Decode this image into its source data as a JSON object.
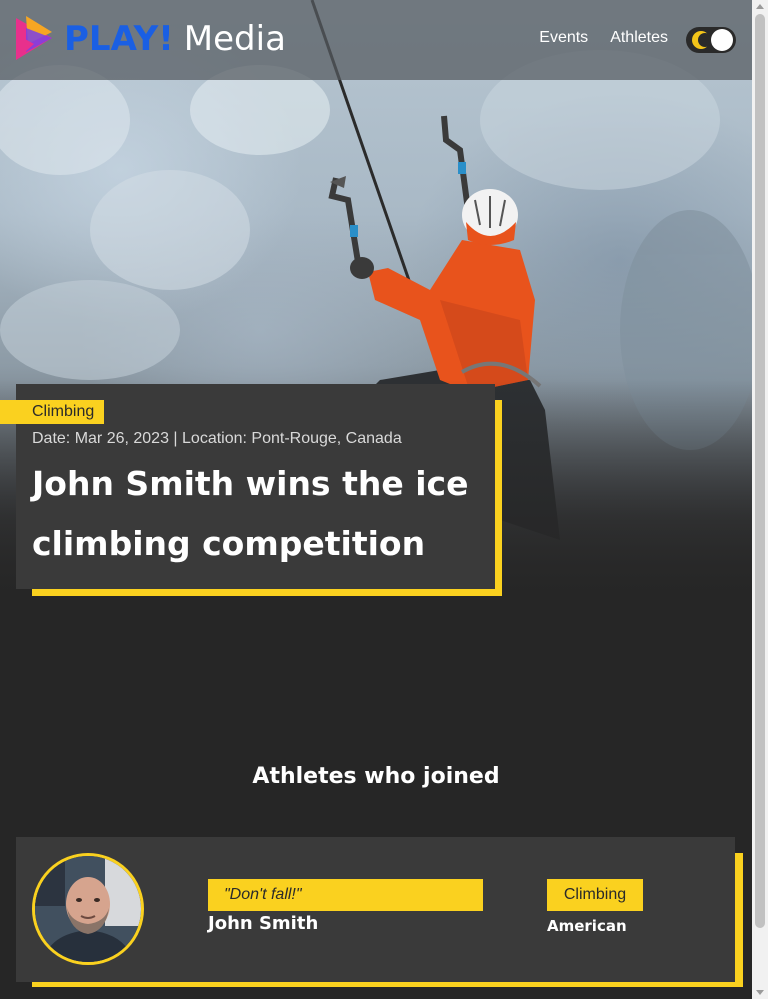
{
  "header": {
    "logo_play": "PLAY!",
    "logo_media": "Media",
    "nav": [
      "Events",
      "Athletes"
    ],
    "theme_toggle_icon": "moon-icon"
  },
  "feature": {
    "category": "Climbing",
    "meta": "Date: Mar 26, 2023 | Location: Pont-Rouge, Canada",
    "title": "John Smith wins the ice climbing competition"
  },
  "athletes_section": {
    "title": "Athletes who joined",
    "athletes": [
      {
        "quote": "\"Don't fall!\"",
        "name": "John Smith",
        "sport": "Climbing",
        "nationality": "American"
      }
    ]
  },
  "colors": {
    "accent": "#fad11f",
    "brand_blue": "#1a5fe3",
    "background": "#262626",
    "card": "#3a3a3a"
  }
}
